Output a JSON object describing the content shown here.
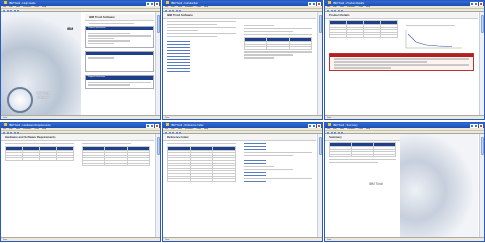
{
  "windows": [
    {
      "title": "IBM Tivoli - Help Guide",
      "menu": [
        "File",
        "Edit",
        "View",
        "Favorites",
        "Tools",
        "Help"
      ],
      "header": "IBM Tivoli Software",
      "logo": "IBM",
      "brand_line1": "IBM Tivoli",
      "brand_line2": "Software",
      "panel1_title": "Product Information",
      "panel2_title": "Support Resources",
      "status": "Done"
    },
    {
      "title": "IBM Tivoli - Introduction",
      "menu": [
        "File",
        "Edit",
        "View",
        "Favorites",
        "Tools",
        "Help"
      ],
      "header": "IBM Tivoli Software",
      "status": "Done"
    },
    {
      "title": "IBM Tivoli - Product Details",
      "menu": [
        "File",
        "Edit",
        "View",
        "Favorites",
        "Tools",
        "Help"
      ],
      "header": "Product Details",
      "status": "Done"
    },
    {
      "title": "IBM Tivoli - Hardware Requirements",
      "menu": [
        "File",
        "Edit",
        "View",
        "Favorites",
        "Tools",
        "Help"
      ],
      "header": "Hardware and Software Requirements",
      "status": "Done"
    },
    {
      "title": "IBM Tivoli - Reference Index",
      "menu": [
        "File",
        "Edit",
        "View",
        "Favorites",
        "Tools",
        "Help"
      ],
      "header": "Reference Index",
      "status": "Done"
    },
    {
      "title": "IBM Tivoli - Summary",
      "menu": [
        "File",
        "Edit",
        "View",
        "Favorites",
        "Tools",
        "Help"
      ],
      "header": "Summary",
      "brand": "IBM Tivoli",
      "status": "Done"
    }
  ]
}
